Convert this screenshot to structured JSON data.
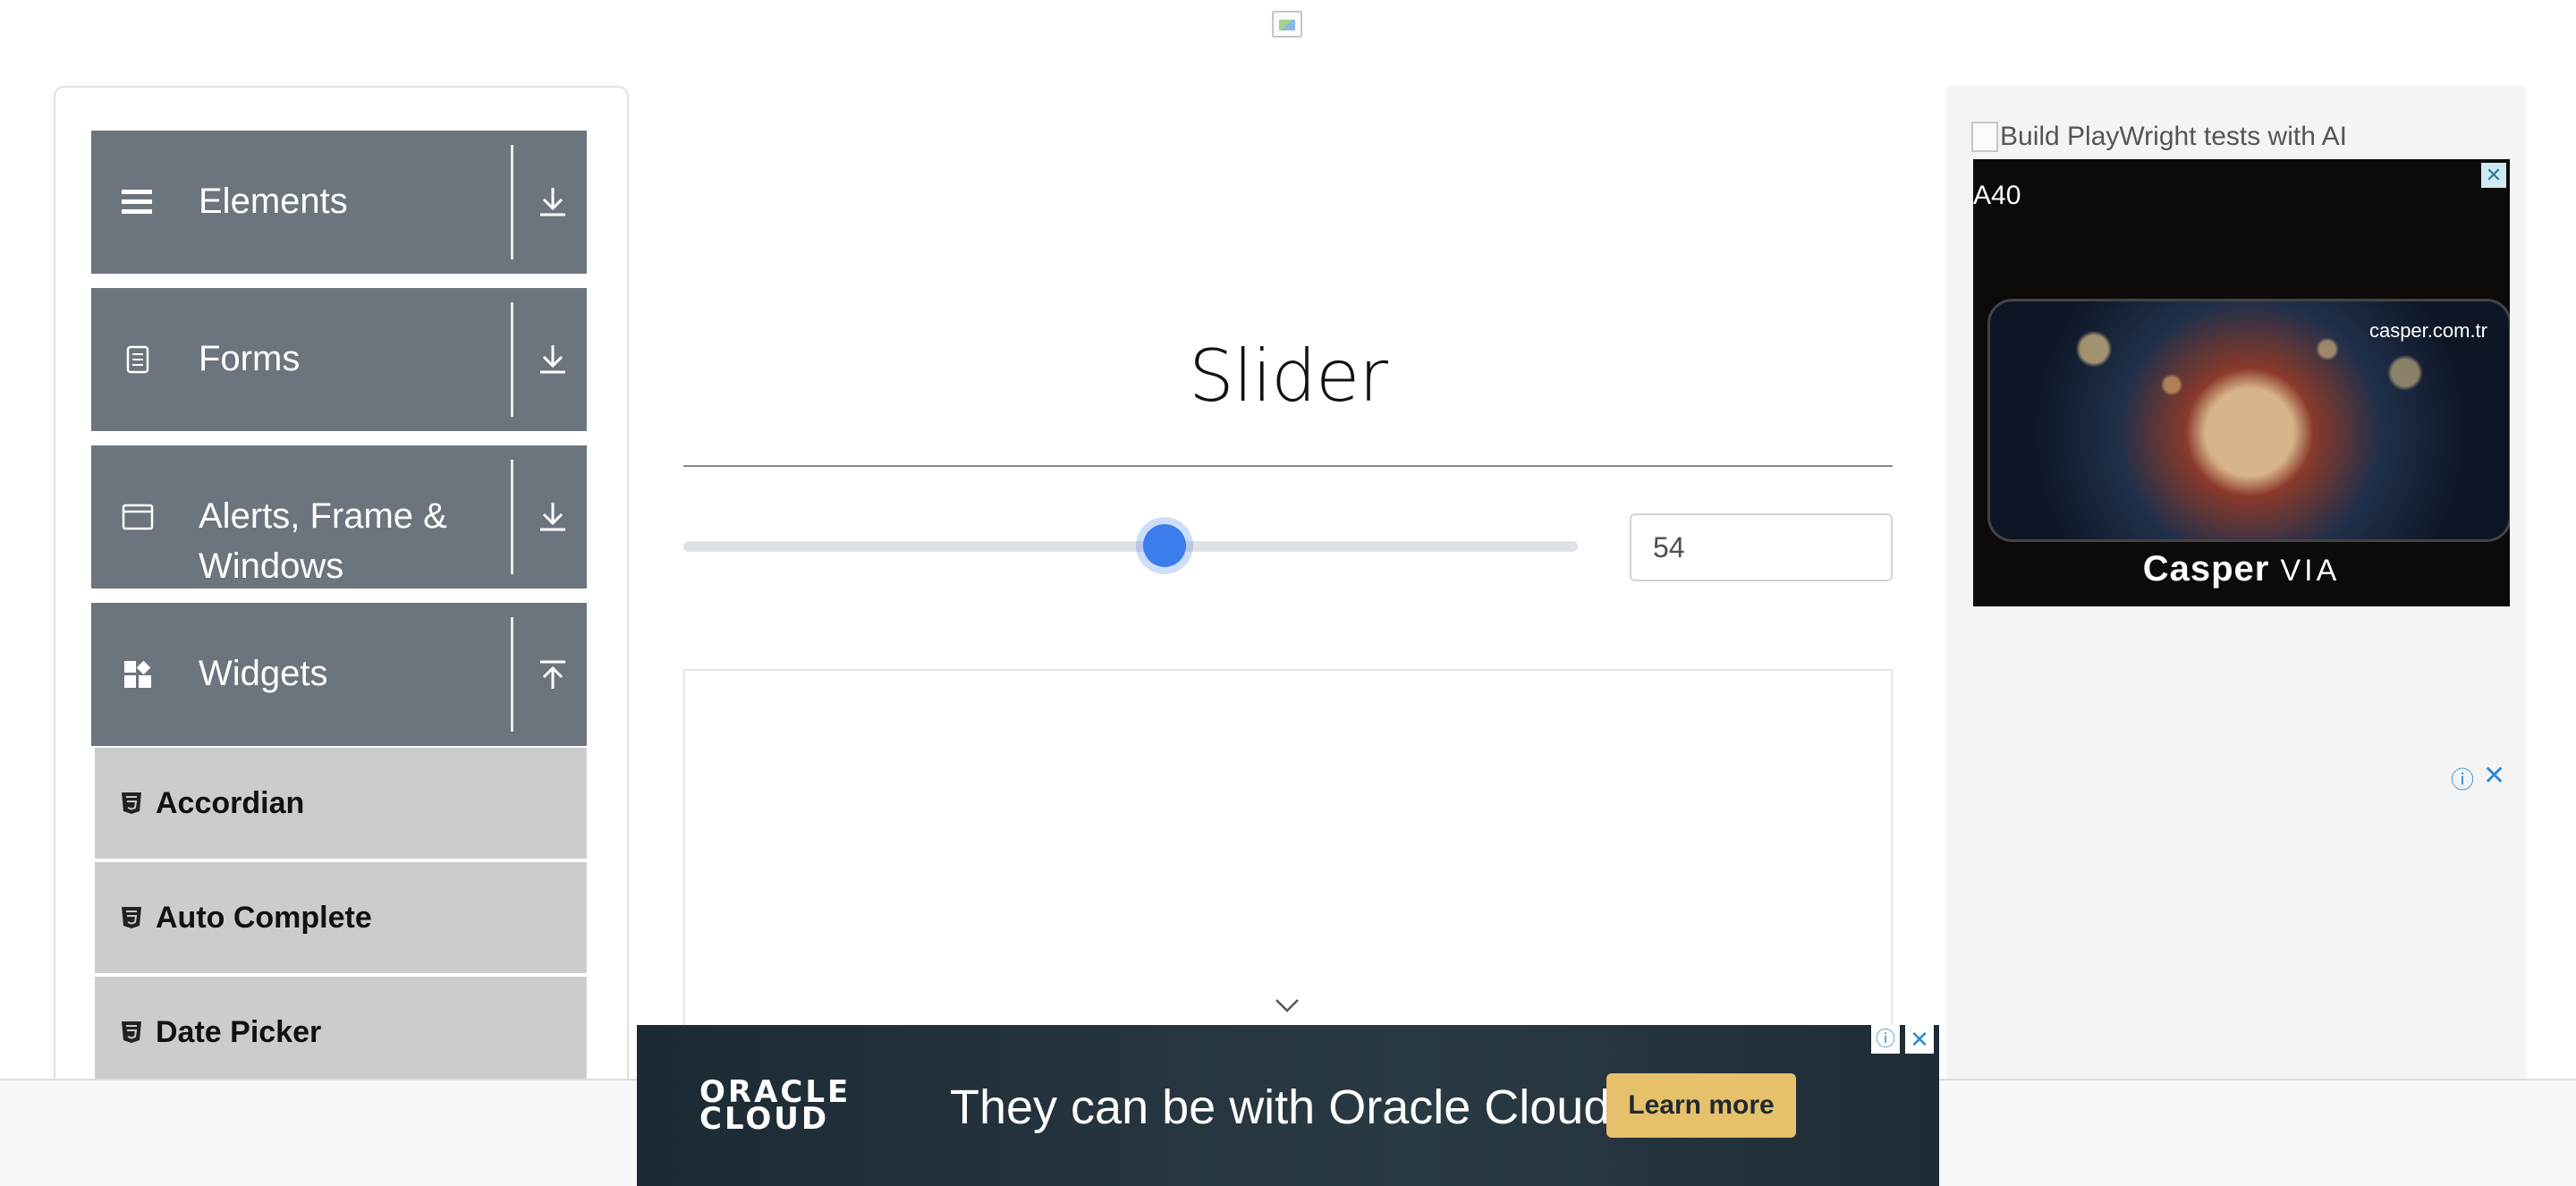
{
  "sidebar": {
    "groups": [
      {
        "label": "Elements",
        "icon": "hamburger-icon",
        "arrow": "download-arrow-icon"
      },
      {
        "label": "Forms",
        "icon": "document-icon",
        "arrow": "download-arrow-icon"
      },
      {
        "label": "Alerts, Frame &",
        "label_line2": "Windows",
        "icon": "window-icon",
        "arrow": "download-arrow-icon"
      },
      {
        "label": "Widgets",
        "icon": "widgets-icon",
        "arrow": "upload-arrow-icon"
      }
    ],
    "widget_items": [
      {
        "label": "Accordian"
      },
      {
        "label": "Auto Complete"
      },
      {
        "label": "Date Picker"
      }
    ]
  },
  "main": {
    "title": "Slider",
    "slider": {
      "value": "54",
      "min": 0,
      "max": 100,
      "accent": "#3b7ded"
    }
  },
  "right_ad": {
    "alt_text": "Build PlayWright tests with AI",
    "code": "A40",
    "site": "casper.com.tr",
    "brand": "Casper",
    "brand_suffix": "VIA",
    "close": "✕",
    "info": "ⓘ",
    "close2": "✕"
  },
  "bottom_ad": {
    "logo_line1": "ORACLE",
    "logo_line2": "CLOUD",
    "headline": "They can be with Oracle Cloud",
    "cta": "Learn more",
    "info": "ⓘ",
    "close": "✕",
    "cta_color": "#e7c06b"
  }
}
